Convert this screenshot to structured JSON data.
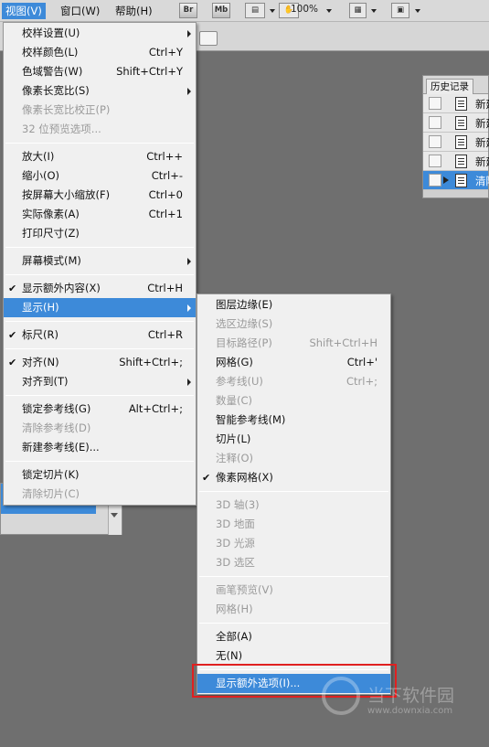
{
  "menubar": {
    "items": [
      "视图(V)",
      "窗口(W)",
      "帮助(H)"
    ],
    "buttons": [
      "Br",
      "Mb"
    ],
    "zoom": "100%"
  },
  "history_panel": {
    "tab": "历史记录",
    "rows": [
      {
        "label": "新建",
        "selected": false
      },
      {
        "label": "新建",
        "selected": false
      },
      {
        "label": "新建",
        "selected": false
      },
      {
        "label": "新建",
        "selected": false
      },
      {
        "label": "清除",
        "selected": true
      }
    ]
  },
  "view_menu": [
    {
      "label": "校样设置(U)",
      "shortcut": "",
      "submenu": true
    },
    {
      "label": "校样颜色(L)",
      "shortcut": "Ctrl+Y"
    },
    {
      "label": "色域警告(W)",
      "shortcut": "Shift+Ctrl+Y"
    },
    {
      "label": "像素长宽比(S)",
      "shortcut": "",
      "submenu": true
    },
    {
      "label": "像素长宽比校正(P)",
      "shortcut": "",
      "disabled": true
    },
    {
      "label": "32 位预览选项...",
      "shortcut": "",
      "disabled": true
    },
    {
      "sep": true
    },
    {
      "label": "放大(I)",
      "shortcut": "Ctrl++"
    },
    {
      "label": "缩小(O)",
      "shortcut": "Ctrl+-"
    },
    {
      "label": "按屏幕大小缩放(F)",
      "shortcut": "Ctrl+0"
    },
    {
      "label": "实际像素(A)",
      "shortcut": "Ctrl+1"
    },
    {
      "label": "打印尺寸(Z)",
      "shortcut": ""
    },
    {
      "sep": true
    },
    {
      "label": "屏幕模式(M)",
      "shortcut": "",
      "submenu": true
    },
    {
      "sep": true
    },
    {
      "label": "显示额外内容(X)",
      "shortcut": "Ctrl+H",
      "checked": true
    },
    {
      "label": "显示(H)",
      "shortcut": "",
      "submenu": true,
      "highlighted": true
    },
    {
      "sep": true
    },
    {
      "label": "标尺(R)",
      "shortcut": "Ctrl+R",
      "checked": true
    },
    {
      "sep": true
    },
    {
      "label": "对齐(N)",
      "shortcut": "Shift+Ctrl+;",
      "checked": true
    },
    {
      "label": "对齐到(T)",
      "shortcut": "",
      "submenu": true
    },
    {
      "sep": true
    },
    {
      "label": "锁定参考线(G)",
      "shortcut": "Alt+Ctrl+;"
    },
    {
      "label": "清除参考线(D)",
      "shortcut": "",
      "disabled": true
    },
    {
      "label": "新建参考线(E)...",
      "shortcut": ""
    },
    {
      "sep": true
    },
    {
      "label": "锁定切片(K)",
      "shortcut": ""
    },
    {
      "label": "清除切片(C)",
      "shortcut": "",
      "disabled": true
    }
  ],
  "show_submenu": [
    {
      "label": "图层边缘(E)",
      "shortcut": ""
    },
    {
      "label": "选区边缘(S)",
      "shortcut": "",
      "disabled": true
    },
    {
      "label": "目标路径(P)",
      "shortcut": "Shift+Ctrl+H",
      "disabled": true
    },
    {
      "label": "网格(G)",
      "shortcut": "Ctrl+'"
    },
    {
      "label": "参考线(U)",
      "shortcut": "Ctrl+;",
      "disabled": true
    },
    {
      "label": "数量(C)",
      "shortcut": "",
      "disabled": true
    },
    {
      "label": "智能参考线(M)",
      "shortcut": ""
    },
    {
      "label": "切片(L)",
      "shortcut": ""
    },
    {
      "label": "注释(O)",
      "shortcut": "",
      "disabled": true
    },
    {
      "label": "像素网格(X)",
      "shortcut": "",
      "checked": true
    },
    {
      "sep": true
    },
    {
      "label": "3D 轴(3)",
      "shortcut": "",
      "disabled": true
    },
    {
      "label": "3D 地面",
      "shortcut": "",
      "disabled": true
    },
    {
      "label": "3D 光源",
      "shortcut": "",
      "disabled": true
    },
    {
      "label": "3D 选区",
      "shortcut": "",
      "disabled": true
    },
    {
      "sep": true
    },
    {
      "label": "画笔预览(V)",
      "shortcut": "",
      "disabled": true
    },
    {
      "label": "网格(H)",
      "shortcut": "",
      "disabled": true
    },
    {
      "sep": true
    },
    {
      "label": "全部(A)",
      "shortcut": ""
    },
    {
      "label": "无(N)",
      "shortcut": ""
    },
    {
      "sep": true
    },
    {
      "label": "显示额外选项(I)...",
      "shortcut": "",
      "highlighted": true
    }
  ],
  "watermark": {
    "text": "当下软件园",
    "url": "www.downxia.com"
  },
  "colors": {
    "highlight": "#3d8ad9",
    "callout": "#e02020"
  }
}
